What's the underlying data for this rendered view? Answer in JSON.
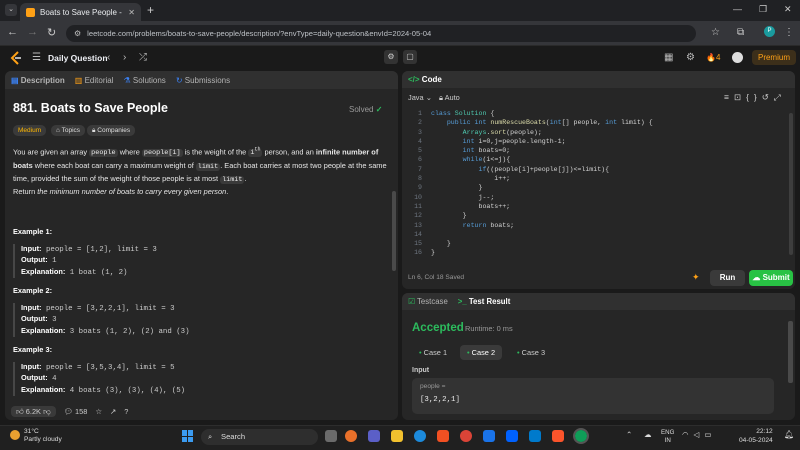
{
  "browser": {
    "tab_title": "Boats to Save People - LeetCode",
    "url": "leetcode.com/problems/boats-to-save-people/description/?envType=daily-question&envId=2024-05-04",
    "profile_initial": "P"
  },
  "lc_header": {
    "daily_question": "Daily Question",
    "streak": "4",
    "premium": "Premium"
  },
  "left_panel": {
    "tabs": [
      "Description",
      "Editorial",
      "Solutions",
      "Submissions"
    ],
    "title": "881. Boats to Save People",
    "solved": "Solved",
    "tags": [
      "Medium",
      "Topics",
      "Companies"
    ],
    "desc": {
      "t1": "You are given an array ",
      "c1": "people",
      "t2": " where ",
      "c2": "people[i]",
      "t3": " is the weight of the ",
      "c3": "i",
      "sup": "th",
      "t4": " person, and an ",
      "b1": "infinite number of boats",
      "t5": " where each boat can carry a maximum weight of ",
      "c4": "limit",
      "t6": ". Each boat carries at most two people at the same time, provided the sum of the weight of those people is at most ",
      "c5": "limit",
      "t7": "."
    },
    "return_pre": "Return ",
    "return_text": "the minimum number of boats to carry every given person",
    "return_post": ".",
    "examples": [
      {
        "header": "Example 1:",
        "input": "people = [1,2], limit = 3",
        "output": "1",
        "explanation": "1 boat (1, 2)"
      },
      {
        "header": "Example 2:",
        "input": "people = [3,2,2,1], limit = 3",
        "output": "3",
        "explanation": "3 boats (1, 2), (2) and (3)"
      },
      {
        "header": "Example 3:",
        "input": "people = [3,5,3,4], limit = 5",
        "output": "4",
        "explanation": "4 boats (3), (3), (4), (5)"
      }
    ],
    "labels": {
      "input": "Input:",
      "output": "Output:",
      "explanation": "Explanation:"
    },
    "footer": {
      "likes": "6.2K",
      "comments": "158"
    }
  },
  "code_panel": {
    "title": "Code",
    "language": "Java",
    "mode": "Auto",
    "line_numbers": [
      "1",
      "2",
      "3",
      "4",
      "5",
      "6",
      "7",
      "8",
      "9",
      "10",
      "11",
      "12",
      "13",
      "14",
      "15",
      "16"
    ],
    "lines": [
      "class Solution {",
      "    public int numRescueBoats(int[] people, int limit) {",
      "        Arrays.sort(people);",
      "        int i=0,j=people.length-1;",
      "        int boats=0;",
      "        while(i<=j){",
      "            if((people[i]+people[j])<=limit){",
      "                i++;",
      "            }",
      "            j--;",
      "            boats++;",
      "        }",
      "        return boats;",
      "",
      "    }",
      "}"
    ],
    "status": "Ln 6, Col 18     Saved",
    "run": "Run",
    "submit": "Submit"
  },
  "result_panel": {
    "tabs": [
      "Testcase",
      "Test Result"
    ],
    "verdict": "Accepted",
    "runtime": "Runtime: 0 ms",
    "cases": [
      "Case 1",
      "Case 2",
      "Case 3"
    ],
    "input_label": "Input",
    "var_name": "people =",
    "var_value": "[3,2,2,1]"
  },
  "taskbar": {
    "temp": "31°C",
    "weather": "Partly cloudy",
    "search": "Search",
    "lang_top": "ENG",
    "lang_bottom": "IN",
    "time": "22:12",
    "date": "04-05-2024"
  },
  "colors": {
    "accent_orange": "#ffa116",
    "accepted_green": "#2cbb5d",
    "submit_green": "#28c244"
  }
}
